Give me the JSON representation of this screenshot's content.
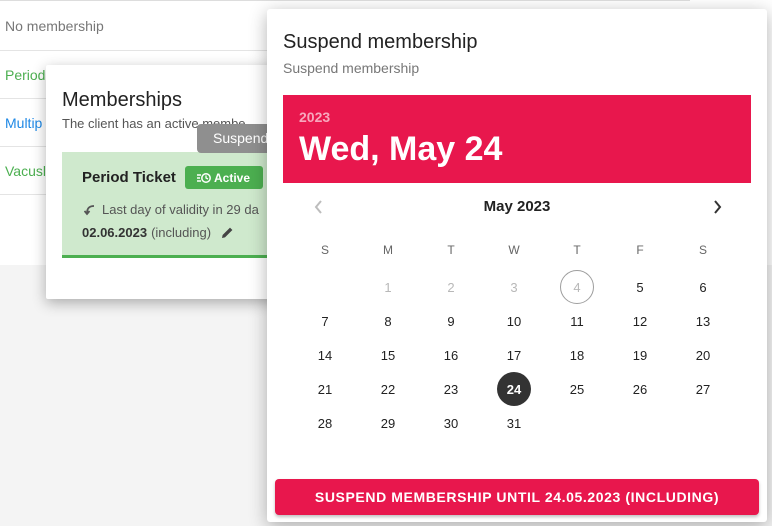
{
  "background_list": {
    "rows": [
      {
        "label": "No membership",
        "color": "#777777"
      },
      {
        "label": "Period",
        "color": "#4caf50"
      },
      {
        "label": "Multip",
        "color": "#1e88e5"
      },
      {
        "label": "Vacusl",
        "color": "#4caf50"
      }
    ]
  },
  "memberships_dialog": {
    "title": "Memberships",
    "subtitle": "The client has an active membe",
    "tooltip": "Suspend",
    "card": {
      "title": "Period Ticket",
      "badge": "Active",
      "validity": "Last day of validity in 29 da",
      "end_date": "02.06.2023",
      "end_suffix": "(including)"
    }
  },
  "suspend_dialog": {
    "title": "Suspend membership",
    "subtitle": "Suspend membership",
    "calendar": {
      "year": "2023",
      "date_display": "Wed, May 24",
      "month_label": "May 2023",
      "weekdays": [
        "S",
        "M",
        "T",
        "W",
        "T",
        "F",
        "S"
      ],
      "first_weekday_index": 1,
      "days_in_month": 31,
      "disabled_before": 5,
      "today": 4,
      "selected": 24
    },
    "button_label": "SUSPEND MEMBERSHIP UNTIL 24.05.2023 (INCLUDING)",
    "accent_color": "#e8174d"
  }
}
